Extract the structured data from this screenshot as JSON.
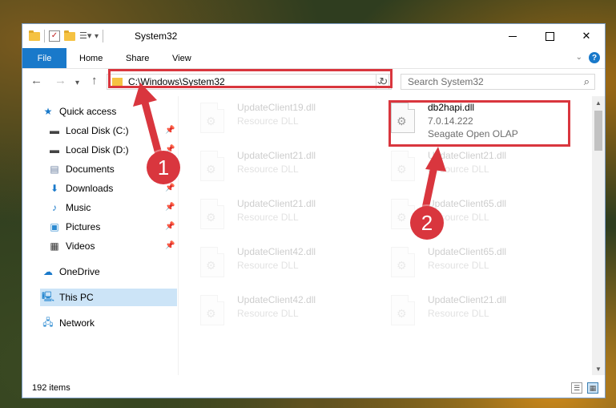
{
  "window": {
    "title": "System32"
  },
  "ribbon": {
    "tabs": [
      "File",
      "Home",
      "Share",
      "View"
    ]
  },
  "address": {
    "path": "C:\\Windows\\System32"
  },
  "search": {
    "placeholder": "Search System32"
  },
  "sidebar": {
    "items": [
      {
        "label": "Quick access",
        "icon": "star-icon",
        "pinned": false
      },
      {
        "label": "Local Disk (C:)",
        "icon": "drive-icon",
        "pinned": true
      },
      {
        "label": "Local Disk (D:)",
        "icon": "drive-icon",
        "pinned": true
      },
      {
        "label": "Documents",
        "icon": "documents-icon",
        "pinned": true
      },
      {
        "label": "Downloads",
        "icon": "download-icon",
        "pinned": true
      },
      {
        "label": "Music",
        "icon": "music-icon",
        "pinned": true
      },
      {
        "label": "Pictures",
        "icon": "pictures-icon",
        "pinned": true
      },
      {
        "label": "Videos",
        "icon": "videos-icon",
        "pinned": true
      },
      {
        "label": "OneDrive",
        "icon": "cloud-icon",
        "pinned": false
      },
      {
        "label": "This PC",
        "icon": "computer-icon",
        "pinned": false,
        "selected": true
      },
      {
        "label": "Network",
        "icon": "network-icon",
        "pinned": false
      }
    ]
  },
  "files": {
    "highlighted": {
      "name": "db2hapi.dll",
      "version": "7.0.14.222",
      "description": "Seagate Open OLAP"
    },
    "background": [
      {
        "name": "UpdateClient19.dll",
        "type": "Resource DLL"
      },
      {
        "name": "UpdateClient21.dll",
        "type": "Resource DLL"
      },
      {
        "name": "UpdateClient21.dll",
        "type": "Resource DLL"
      },
      {
        "name": "UpdateClient65.dll",
        "type": "Resource DLL"
      },
      {
        "name": "UpdateClient42.dll",
        "type": "Resource DLL"
      },
      {
        "name": "UpdateClient65.dll",
        "type": "Resource DLL"
      },
      {
        "name": "UpdateClient42.dll",
        "type": "Resource DLL"
      },
      {
        "name": "UpdateClient21.dll",
        "type": "Resource DLL"
      }
    ]
  },
  "status": {
    "item_count": "192 items"
  },
  "annotations": {
    "step1": "1",
    "step2": "2"
  },
  "colors": {
    "accent": "#1979ca",
    "highlight": "#d9363e",
    "selected": "#cce4f7"
  }
}
